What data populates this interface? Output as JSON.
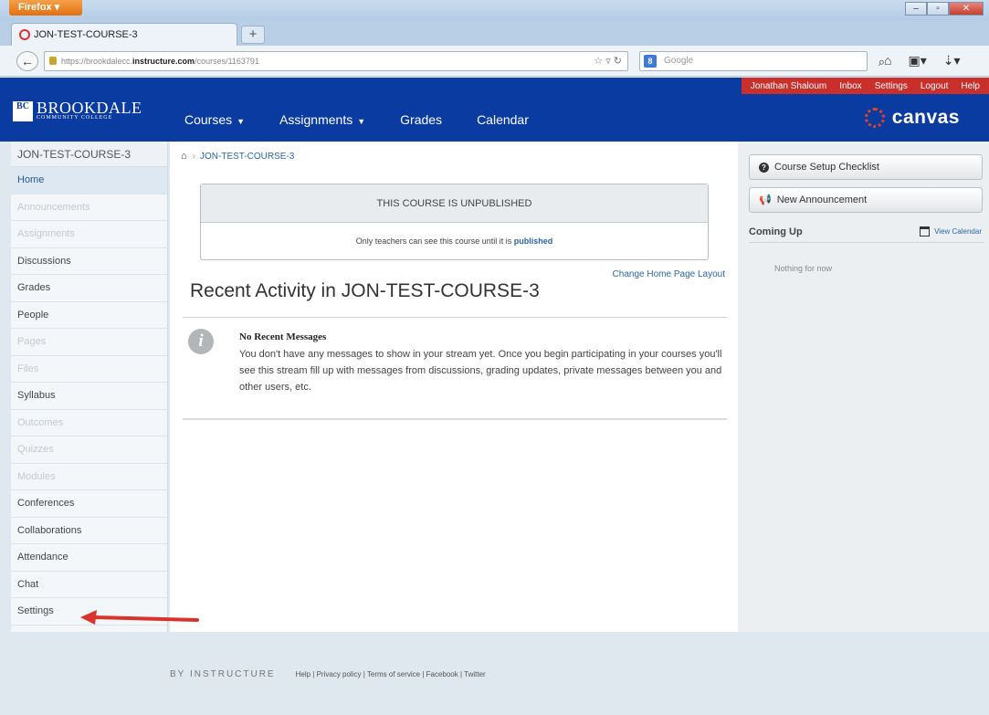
{
  "browser": {
    "menu_label": "Firefox",
    "tab_title": "JON-TEST-COURSE-3",
    "new_tab": "+",
    "url_prefix": "https://brookdalecc.",
    "url_host": "instructure.com",
    "url_path": "/courses/1163791",
    "search_placeholder": "Google",
    "search_engine_badge": "8"
  },
  "header": {
    "logo_line1": "BROOKDALE",
    "logo_line2": "COMMUNITY COLLEGE",
    "logo_mark": "BC",
    "nav": [
      {
        "label": "Courses",
        "dropdown": true
      },
      {
        "label": "Assignments",
        "dropdown": true
      },
      {
        "label": "Grades",
        "dropdown": false
      },
      {
        "label": "Calendar",
        "dropdown": false
      }
    ],
    "user_links": {
      "user": "Jonathan Shaloum",
      "inbox": "Inbox",
      "settings": "Settings",
      "logout": "Logout",
      "help": "Help"
    },
    "brand": "canvas"
  },
  "course_nav": {
    "title": "JON-TEST-COURSE-3",
    "items": [
      {
        "label": "Home",
        "state": "active"
      },
      {
        "label": "Announcements",
        "state": "disabled"
      },
      {
        "label": "Assignments",
        "state": "disabled"
      },
      {
        "label": "Discussions",
        "state": "normal"
      },
      {
        "label": "Grades",
        "state": "normal"
      },
      {
        "label": "People",
        "state": "normal"
      },
      {
        "label": "Pages",
        "state": "disabled"
      },
      {
        "label": "Files",
        "state": "disabled"
      },
      {
        "label": "Syllabus",
        "state": "normal"
      },
      {
        "label": "Outcomes",
        "state": "disabled"
      },
      {
        "label": "Quizzes",
        "state": "disabled"
      },
      {
        "label": "Modules",
        "state": "disabled"
      },
      {
        "label": "Conferences",
        "state": "normal"
      },
      {
        "label": "Collaborations",
        "state": "normal"
      },
      {
        "label": "Attendance",
        "state": "normal"
      },
      {
        "label": "Chat",
        "state": "normal"
      },
      {
        "label": "Settings",
        "state": "normal"
      }
    ]
  },
  "content": {
    "breadcrumb": "JON-TEST-COURSE-3",
    "unpublished_heading": "THIS COURSE IS UNPUBLISHED",
    "unpublished_text": "Only teachers can see this course until it is",
    "published_link": "published",
    "change_layout": "Change Home Page Layout",
    "activity_title": "Recent Activity in JON-TEST-COURSE-3",
    "message_title": "No Recent Messages",
    "message_body": "You don't have any messages to show in your stream yet. Once you begin participating in your courses you'll see this stream fill up with messages from discussions, grading updates, private messages between you and other users, etc."
  },
  "sidebar": {
    "setup_checklist": "Course Setup Checklist",
    "new_announcement": "New Announcement",
    "coming_up": "Coming Up",
    "view_calendar": "View Calendar",
    "nothing": "Nothing for now"
  },
  "footer": {
    "brand": "BY INSTRUCTURE",
    "links": "Help | Privacy policy | Terms of service | Facebook | Twitter"
  },
  "colors": {
    "header_blue": "#0a3ba1",
    "user_bar_red": "#c9302c",
    "link_blue": "#2a66a8",
    "arrow_red": "#d9342b"
  }
}
